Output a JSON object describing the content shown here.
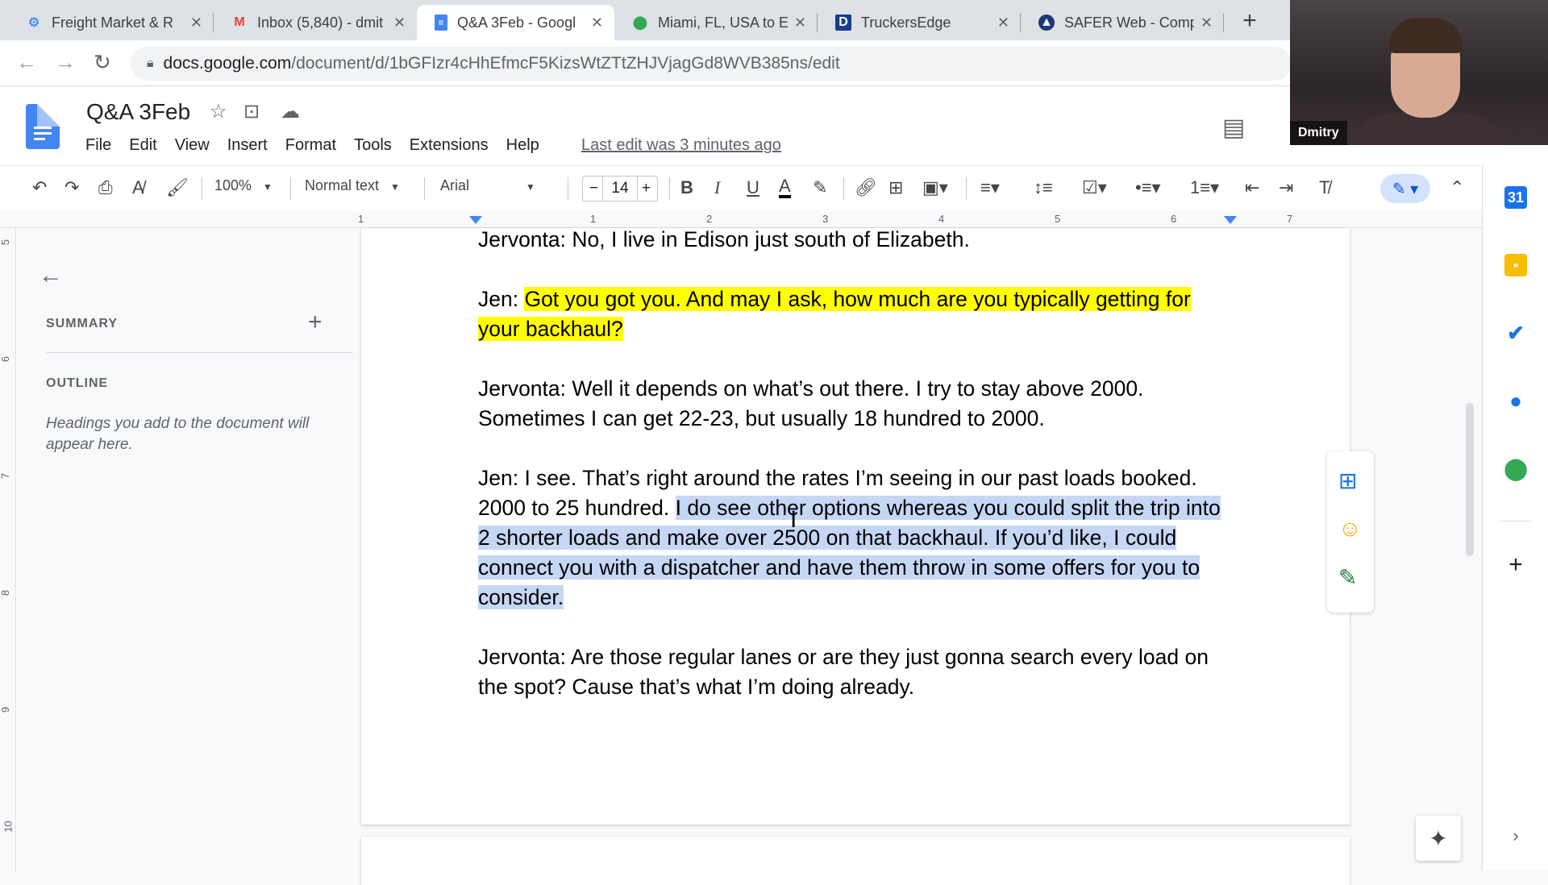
{
  "browser": {
    "tabs": [
      {
        "title": "Freight Market & R",
        "icon": "gear-icon"
      },
      {
        "title": "Inbox (5,840) - dmit",
        "icon": "gmail-icon"
      },
      {
        "title": "Q&A 3Feb - Googl",
        "icon": "docs-icon",
        "active": true
      },
      {
        "title": "Miami, FL, USA to E",
        "icon": "maps-pin-icon"
      },
      {
        "title": "TruckersEdge",
        "icon": "truckersedge-icon"
      },
      {
        "title": "SAFER Web - Comp",
        "icon": "safer-icon"
      }
    ],
    "url_host": "docs.google.com",
    "url_path": "/document/d/1bGFIzr4cHhEfmcF5KizsWtZTtZHJVjagGd8WVB385ns/edit"
  },
  "webcam": {
    "name": "Dmitry"
  },
  "docs": {
    "title": "Q&A 3Feb",
    "menu": [
      "File",
      "Edit",
      "View",
      "Insert",
      "Format",
      "Tools",
      "Extensions",
      "Help"
    ],
    "last_edit": "Last edit was 3 minutes ago"
  },
  "toolbar": {
    "zoom": "100%",
    "style": "Normal text",
    "font": "Arial",
    "font_size": "14"
  },
  "ruler": [
    "1",
    "1",
    "2",
    "3",
    "4",
    "5",
    "6",
    "7"
  ],
  "vruler": [
    "5",
    "6",
    "7",
    "8",
    "9",
    "10"
  ],
  "outline_panel": {
    "summary": "SUMMARY",
    "outline": "OUTLINE",
    "hint": "Headings you add to the document will appear here."
  },
  "document": {
    "p1": "Jervonta: No, I live in Edison just south of Elizabeth.",
    "p2_prefix": "Jen: ",
    "p2_highlight": "Got you got you. And may I ask, how much are you typically getting for your backhaul?",
    "p3": "Jervonta: Well it depends on what’s out there. I try to stay above 2000. Sometimes I can get 22-23, but usually 18 hundred to 2000.",
    "p4_plain": "Jen: I see. That’s right around the rates I’m seeing in our past loads booked. 2000 to 25 hundred. ",
    "p4_selected": "I do see other options whereas you could split the trip into 2 shorter loads and make over 2500 on that backhaul. If you’d like, I could connect you with a dispatcher and have them throw in some offers for you to consider. ",
    "p5": "Jervonta: Are those regular lanes or are they just gonna search every load on the spot? Cause that’s what I’m doing already."
  },
  "colors": {
    "highlight": "#ffff00",
    "selection": "#c6d6f5",
    "accent": "#1a73e8"
  }
}
